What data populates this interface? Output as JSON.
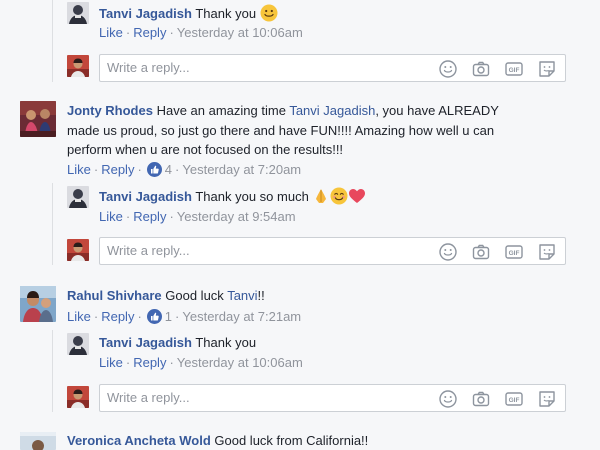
{
  "comments": [
    {
      "id": "c0-reply",
      "author": "Tanvi Jagadish",
      "text": "Thank you",
      "actions": {
        "like": "Like",
        "reply": "Reply",
        "time": "Yesterday at 10:06am"
      }
    },
    {
      "id": "c1",
      "author": "Jonty Rhodes",
      "text_part1": "Have an amazing time ",
      "mention": "Tanvi Jagadish",
      "text_part2": ", you have ALREADY",
      "line2": "made us proud, so just go there and have FUN!!!! Amazing how well u can",
      "line3": "perform when u are not focused on the results!!!",
      "actions": {
        "like": "Like",
        "reply": "Reply",
        "likes": "4",
        "time": "Yesterday at 7:20am"
      },
      "reply": {
        "author": "Tanvi Jagadish",
        "text": "Thank you so much",
        "actions": {
          "like": "Like",
          "reply": "Reply",
          "time": "Yesterday at 9:54am"
        }
      }
    },
    {
      "id": "c2",
      "author": "Rahul Shivhare",
      "text": "Good luck ",
      "mention": "Tanvi",
      "text_after": "!!",
      "actions": {
        "like": "Like",
        "reply": "Reply",
        "likes": "1",
        "time": "Yesterday at 7:21am"
      },
      "reply": {
        "author": "Tanvi Jagadish",
        "text": "Thank you",
        "actions": {
          "like": "Like",
          "reply": "Reply",
          "time": "Yesterday at 10:06am"
        }
      }
    },
    {
      "id": "c3",
      "author": "Veronica Ancheta Wold",
      "text": "Good luck from California!!"
    }
  ],
  "reply_box": {
    "placeholder": "Write a reply..."
  },
  "colors": {
    "link": "#365899",
    "action": "#4267b2",
    "meta": "#90949c",
    "background": "#f6f7f9"
  }
}
